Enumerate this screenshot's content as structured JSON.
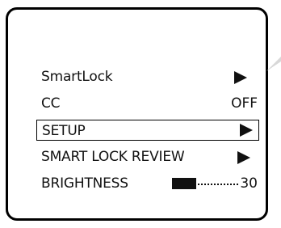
{
  "menu": {
    "items": [
      {
        "label": "SmartLock",
        "value": "",
        "icon": "right-arrow-icon"
      },
      {
        "label": "CC",
        "value": "OFF",
        "icon": ""
      },
      {
        "label": "SETUP",
        "value": "",
        "icon": "right-arrow-icon",
        "selected": true
      },
      {
        "label": "SMART LOCK REVIEW",
        "value": "",
        "icon": "right-arrow-icon"
      },
      {
        "label": "BRIGHTNESS",
        "value": "30",
        "icon": "",
        "level": 0.36
      }
    ]
  },
  "colors": {
    "text": "#111111",
    "frame": "#000000",
    "background": "#ffffff"
  }
}
